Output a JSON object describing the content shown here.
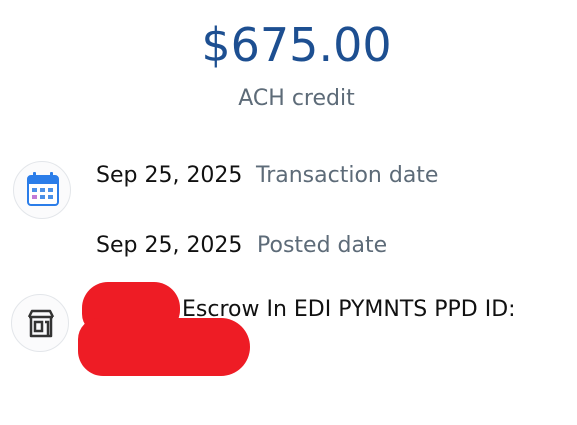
{
  "transaction": {
    "amount": "$675.00",
    "type": "ACH credit"
  },
  "details": {
    "transaction_date": {
      "value": "Sep 25, 2025",
      "label": "Transaction date"
    },
    "posted_date": {
      "value": "Sep 25, 2025",
      "label": "Posted date"
    },
    "merchant": {
      "description": "Escrow In EDI PYMNTS PPD ID:"
    }
  },
  "icons": {
    "calendar": "calendar-icon",
    "store": "store-icon"
  },
  "colors": {
    "amount": "#1d4f91",
    "secondary_text": "#5d6b78",
    "calendar_accent": "#2b7de9",
    "redaction": "#ee1c25"
  }
}
